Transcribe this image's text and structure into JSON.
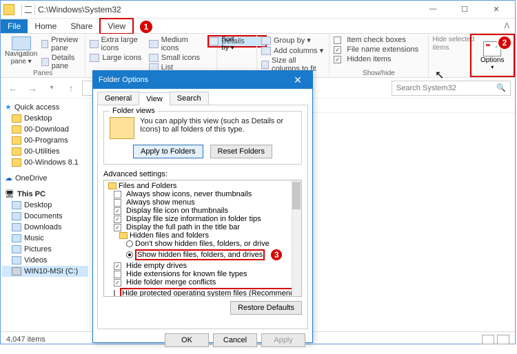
{
  "titlebar": {
    "path": "C:\\Windows\\System32"
  },
  "menu": {
    "file": "File",
    "home": "Home",
    "share": "Share",
    "view": "View"
  },
  "ribbon": {
    "navpane": "Navigation\npane ▾",
    "previewpane": "Preview pane",
    "detailspane": "Details pane",
    "panes_label": "Panes",
    "xl": "Extra large icons",
    "lg": "Large icons",
    "md": "Medium icons",
    "sm": "Small icons",
    "list": "List",
    "details": "Details",
    "sort": "Sort\nby ▾",
    "groupby": "Group by ▾",
    "addcols": "Add columns ▾",
    "sizecols": "Size all columns to fit",
    "chk_boxes": "Item check boxes",
    "chk_ext": "File name extensions",
    "chk_hidden": "Hidden items",
    "hidesel": "Hide selected\nitems",
    "showhide_label": "Show/hide",
    "options": "Options"
  },
  "search": {
    "placeholder": "Search System32"
  },
  "tree": {
    "quick": "Quick access",
    "items": [
      "Desktop",
      "00-Download",
      "00-Programs",
      "00-Utilities",
      "00-Windows 8.1"
    ],
    "onedrive": "OneDrive",
    "thispc": "This PC",
    "pc": [
      "Desktop",
      "Documents",
      "Downloads",
      "Music",
      "Pictures",
      "Videos"
    ],
    "drive": "WIN10-MSI (C:)"
  },
  "cols": {
    "date": "te modified",
    "type": "Type",
    "size": "Size"
  },
  "rows": [
    {
      "d": "16/2016 7:1…",
      "t": "File folder"
    },
    {
      "d": "/6/2016 4:4…",
      "t": "File folder"
    },
    {
      "d": "16/2016 7:3…",
      "t": "File folder"
    },
    {
      "d": "/29/2016 9:…",
      "t": "File folder"
    },
    {
      "d": "13/2016 12:…",
      "t": "File folder"
    },
    {
      "d": "13/2016 12:…",
      "t": "File folder"
    },
    {
      "d": "/14/2016 4:…",
      "t": "File folder"
    },
    {
      "d": "16/2016 7:2…",
      "t": "File folder"
    },
    {
      "d": "/19/2016 8:…",
      "t": "File folder"
    },
    {
      "d": "28/2017 2:0…",
      "t": "File folder"
    },
    {
      "d": "12/2016 10:…",
      "t": "File folder"
    },
    {
      "d": "16/2016 7:1…",
      "t": "File folder"
    },
    {
      "d": "16/2016 8:4…",
      "t": "File folder"
    },
    {
      "d": "16/2016 7:4…",
      "t": "File folder"
    },
    {
      "d": "13/2016 12:…",
      "t": "File folder"
    },
    {
      "d": "13/2016 12:…",
      "t": "File folder"
    },
    {
      "d": "13/2016 3:3…",
      "t": "File folder"
    }
  ],
  "status": {
    "items": "4,047 items"
  },
  "dialog": {
    "title": "Folder Options",
    "tabs": {
      "general": "General",
      "view": "View",
      "search": "Search"
    },
    "fv_group": "Folder views",
    "fv_text": "You can apply this view (such as Details or Icons) to all folders of this type.",
    "apply_folders": "Apply to Folders",
    "reset_folders": "Reset Folders",
    "adv_label": "Advanced settings:",
    "adv": {
      "root": "Files and Folders",
      "i1": "Always show icons, never thumbnails",
      "i2": "Always show menus",
      "i3": "Display file icon on thumbnails",
      "i4": "Display file size information in folder tips",
      "i5": "Display the full path in the title bar",
      "hidden": "Hidden files and folders",
      "r1": "Don't show hidden files, folders, or drive",
      "r2": "Show hidden files, folders, and drives",
      "i6": "Hide empty drives",
      "i7": "Hide extensions for known file types",
      "i8": "Hide folder merge conflicts",
      "i9": "Hide protected operating system files (Recommended)"
    },
    "restore": "Restore Defaults",
    "ok": "OK",
    "cancel": "Cancel",
    "apply": "Apply"
  }
}
